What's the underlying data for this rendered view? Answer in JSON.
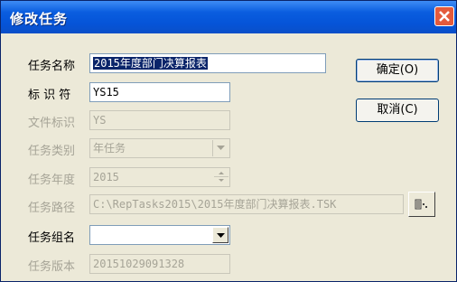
{
  "title": "修改任务",
  "labels": {
    "task_name": "任务名称",
    "identifier": "标 识 符",
    "file_id": "文件标识",
    "task_type": "任务类别",
    "task_year": "任务年度",
    "task_path": "任务路径",
    "task_group": "任务组名",
    "task_version": "任务版本"
  },
  "values": {
    "task_name": "2015年度部门决算报表",
    "identifier": "YS15",
    "file_id": "YS",
    "task_type": "年任务",
    "task_year": "2015",
    "task_path": "C:\\RepTasks2015\\2015年度部门决算报表.TSK",
    "task_group": "",
    "task_version": "20151029091328"
  },
  "buttons": {
    "ok": "确定(O)",
    "cancel": "取消(C)"
  },
  "icons": {
    "close": "close-icon",
    "dropdown": "chevron-down-icon",
    "spin": "spin-arrows-icon",
    "browse": "folder-browse-icon"
  }
}
